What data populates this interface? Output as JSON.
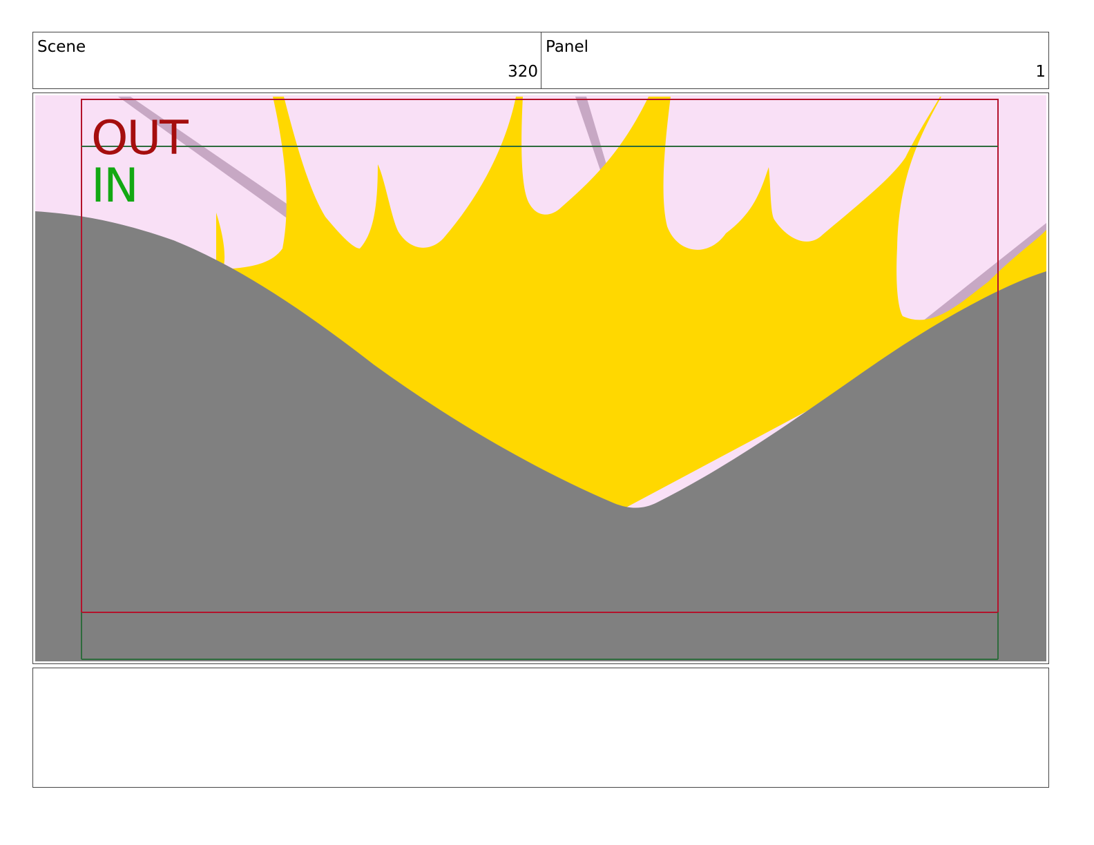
{
  "header": {
    "scene_label": "Scene",
    "scene_value": "320",
    "panel_label": "Panel",
    "panel_value": "1"
  },
  "frame": {
    "out_label": "OUT",
    "in_label": "IN",
    "colors": {
      "sky": "#f9e0f6",
      "streak": "#c7a8c4",
      "splash": "#ffd800",
      "ground": "#808080",
      "out": "#a50e0e",
      "in": "#13a813",
      "out_frame": "#b3122b",
      "in_frame": "#2d6b3c"
    }
  },
  "notes": {
    "text": ""
  }
}
